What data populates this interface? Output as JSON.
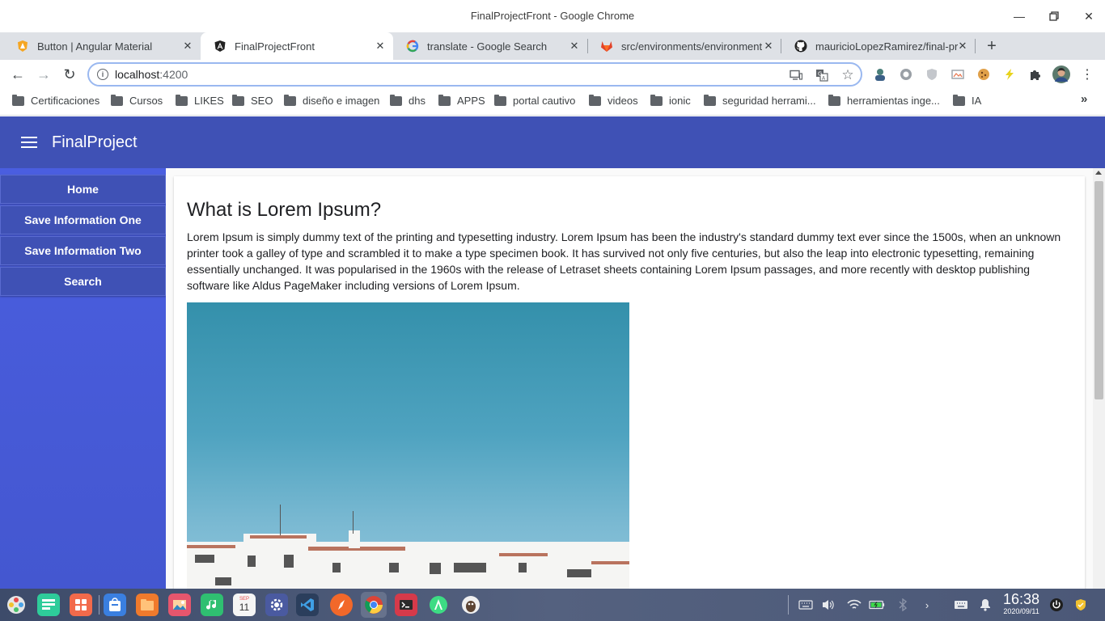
{
  "window": {
    "title": "FinalProjectFront - Google Chrome",
    "controls": [
      "minimize",
      "maximize",
      "close"
    ]
  },
  "tabs": [
    {
      "label": "Button | Angular Material",
      "icon": "angular-material-icon",
      "active": false
    },
    {
      "label": "FinalProjectFront",
      "icon": "angular-icon",
      "active": true
    },
    {
      "label": "translate - Google Search",
      "icon": "google-icon",
      "active": false
    },
    {
      "label": "src/environments/environment",
      "icon": "gitlab-icon",
      "active": false
    },
    {
      "label": "mauricioLopezRamirez/final-pr",
      "icon": "github-icon",
      "active": false
    }
  ],
  "address_bar": {
    "url_host": "localhost",
    "url_port": ":4200"
  },
  "bookmarks": [
    "Certificaciones",
    "Cursos",
    "LIKES",
    "SEO",
    "diseño e imagen",
    "dhs",
    "APPS",
    "portal cautivo",
    "videos",
    "ionic",
    "seguridad herrami...",
    "herramientas inge...",
    "IA"
  ],
  "app": {
    "title": "FinalProject",
    "nav": [
      "Home",
      "Save Information One",
      "Save Information Two",
      "Search"
    ],
    "article": {
      "heading": "What is Lorem Ipsum?",
      "body": "Lorem Ipsum is simply dummy text of the printing and typesetting industry. Lorem Ipsum has been the industry's standard dummy text ever since the 1500s, when an unknown printer took a galley of type and scrambled it to make a type specimen book. It has survived not only five centuries, but also the leap into electronic typesetting, remaining essentially unchanged. It was popularised in the 1960s with the release of Letraset sheets containing Lorem Ipsum passages, and more recently with desktop publishing software like Aldus PageMaker including versions of Lorem Ipsum."
    }
  },
  "taskbar": {
    "calendar_day": "11",
    "calendar_month": "SEP",
    "time": "16:38",
    "date": "2020/09/11"
  },
  "colors": {
    "primary": "#3f51b5",
    "sidenav": "#4a5ee0"
  }
}
